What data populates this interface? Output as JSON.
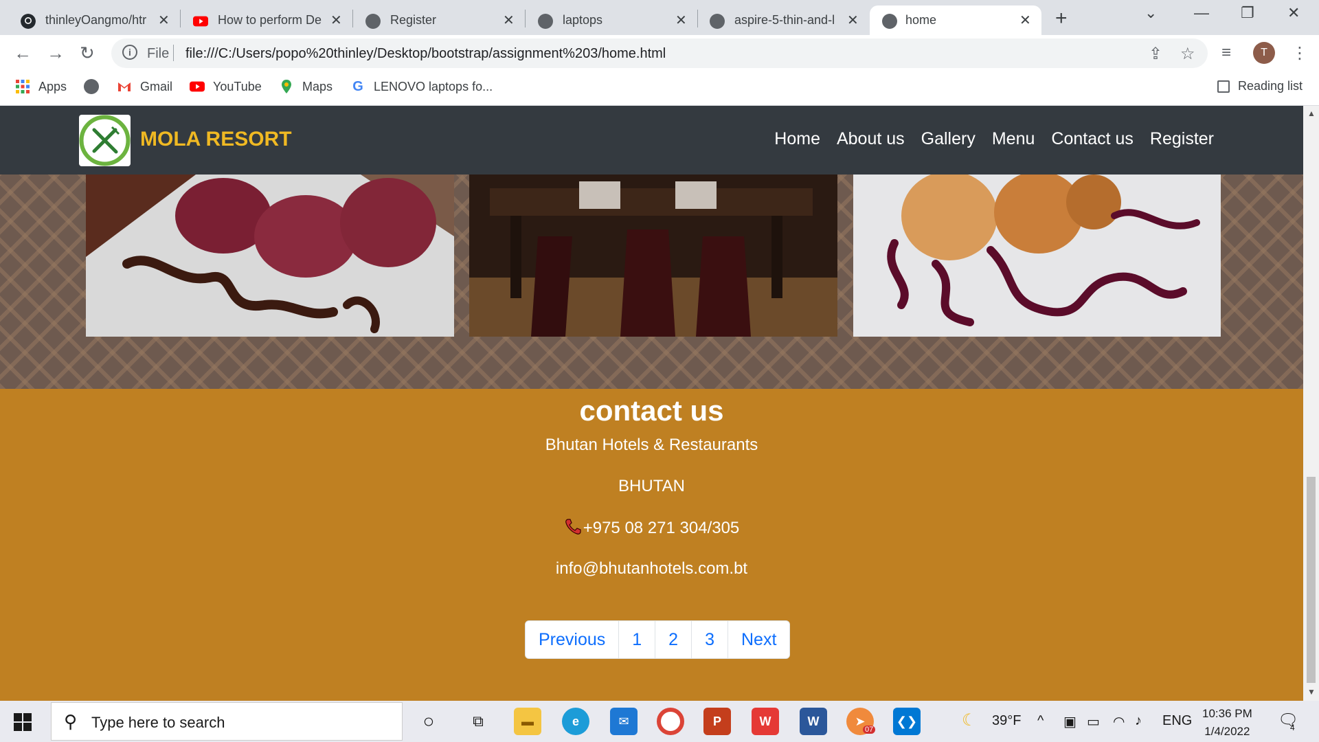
{
  "browser": {
    "tabs": [
      {
        "title": "thinleyOangmo/htr",
        "icon": "github-icon",
        "active": false
      },
      {
        "title": "How to perform De",
        "icon": "youtube-icon",
        "active": false
      },
      {
        "title": "Register",
        "icon": "globe-icon",
        "active": false
      },
      {
        "title": "laptops",
        "icon": "globe-icon",
        "active": false
      },
      {
        "title": "aspire-5-thin-and-l",
        "icon": "globe-icon",
        "active": false
      },
      {
        "title": "home",
        "icon": "globe-icon",
        "active": true
      }
    ],
    "omnibox": {
      "scheme_label": "File",
      "url": "file:///C:/Users/popo%20thinley/Desktop/bootstrap/assignment%203/home.html"
    },
    "profile_initial": "T",
    "bookmarks": {
      "apps": "Apps",
      "gmail": "Gmail",
      "youtube": "YouTube",
      "maps": "Maps",
      "lenovo": "LENOVO laptops fo...",
      "reading_list": "Reading list"
    }
  },
  "site": {
    "brand": "MOLA RESORT",
    "nav": {
      "home": "Home",
      "about": "About us",
      "gallery": "Gallery",
      "menu": "Menu",
      "contact": "Contact us",
      "register": "Register"
    },
    "contact": {
      "title": "contact us",
      "company": "Bhutan Hotels & Restaurants",
      "country": "BHUTAN",
      "phone": "+975 08 271 304/305",
      "email": "info@bhutanhotels.com.bt"
    },
    "pagination": {
      "previous": "Previous",
      "page1": "1",
      "page2": "2",
      "page3": "3",
      "next": "Next"
    },
    "colors": {
      "navbar": "#343a40",
      "brand": "#f0b923",
      "contact_bg": "#bf8022",
      "link": "#0d6efd"
    }
  },
  "taskbar": {
    "search_placeholder": "Type here to search",
    "weather": "39°F",
    "language": "ENG",
    "time": "10:36 PM",
    "date": "1/4/2022",
    "notification_count": "4",
    "telegram_badge": "07"
  }
}
